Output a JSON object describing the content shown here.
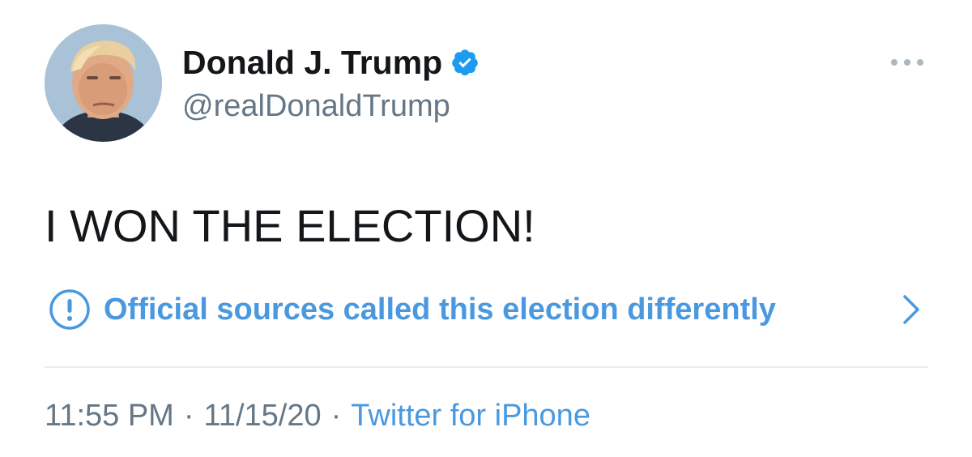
{
  "user": {
    "display_name": "Donald J. Trump",
    "handle": "@realDonaldTrump",
    "verified": true
  },
  "tweet": {
    "text": "I WON THE ELECTION!"
  },
  "notice": {
    "text": "Official sources called this election differently"
  },
  "meta": {
    "time": "11:55 PM",
    "separator": "·",
    "date": "11/15/20",
    "source": "Twitter for iPhone"
  },
  "icons": {
    "avatar": "profile-photo",
    "verified": "verified-badge-icon",
    "more": "more-options-icon",
    "notice": "exclamation-circle-icon",
    "chevron": "chevron-right-icon"
  },
  "colors": {
    "accent": "#4a99e0",
    "verified_badge": "#1d9bf0",
    "text_primary": "#14171a",
    "text_secondary": "#657786",
    "divider": "#e6ecf0"
  }
}
